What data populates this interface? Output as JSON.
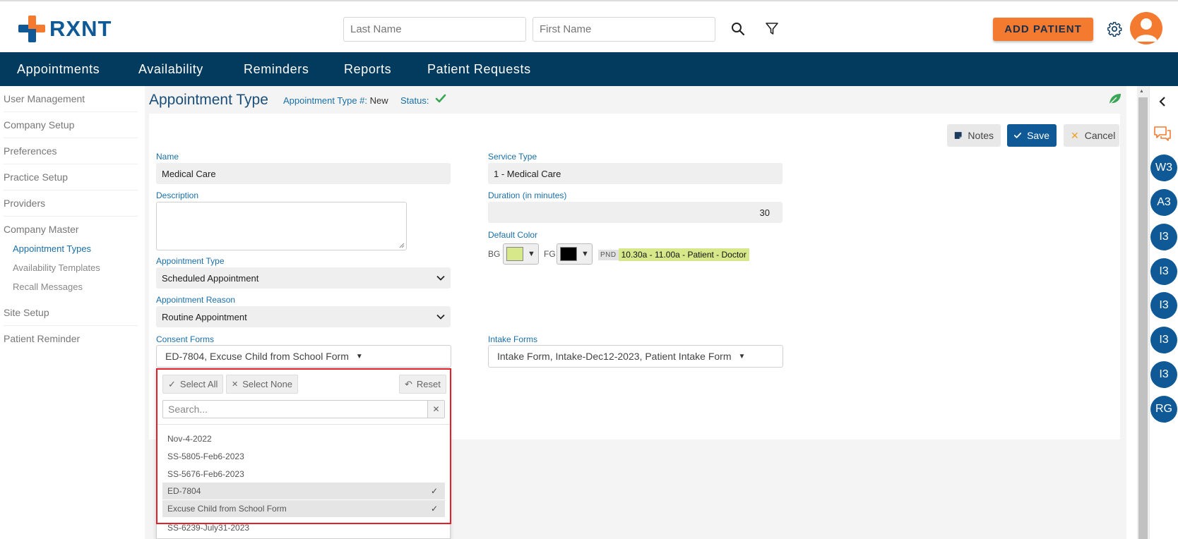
{
  "header": {
    "logo_text": "RXNT",
    "last_name_placeholder": "Last Name",
    "first_name_placeholder": "First Name",
    "add_patient_label": "ADD PATIENT"
  },
  "nav": {
    "items": [
      "Appointments",
      "Availability",
      "Reminders",
      "Reports",
      "Patient Requests"
    ]
  },
  "sidebar": {
    "items": [
      "User Management",
      "Company Setup",
      "Preferences",
      "Practice Setup",
      "Providers",
      "Company Master"
    ],
    "sub_items": [
      "Appointment Types",
      "Availability Templates",
      "Recall Messages"
    ],
    "items_after": [
      "Site Setup",
      "Patient Reminder"
    ]
  },
  "page": {
    "title": "Appointment Type",
    "type_number_label": "Appointment Type #:",
    "type_number_value": "New",
    "status_label": "Status:"
  },
  "actions": {
    "notes": "Notes",
    "save": "Save",
    "cancel": "Cancel"
  },
  "form": {
    "name_label": "Name",
    "name_value": "Medical Care",
    "description_label": "Description",
    "appointment_type_label": "Appointment Type",
    "appointment_type_value": "Scheduled Appointment",
    "appointment_reason_label": "Appointment Reason",
    "appointment_reason_value": "Routine Appointment",
    "consent_forms_label": "Consent Forms",
    "consent_forms_value": "ED-7804,  Excuse Child from School Form",
    "service_type_label": "Service Type",
    "service_type_value": "1 - Medical Care",
    "duration_label": "Duration (in minutes)",
    "duration_value": "30",
    "default_color_label": "Default Color",
    "bg_label": "BG",
    "fg_label": "FG",
    "bg_color": "#d6e88a",
    "fg_color": "#000000",
    "preview_tag": "PND",
    "preview_text": "10.30a - 11.00a - Patient - Doctor",
    "intake_forms_label": "Intake Forms",
    "intake_forms_value": "Intake Form,  Intake-Dec12-2023,  Patient Intake Form"
  },
  "dropdown": {
    "select_all": "Select All",
    "select_none": "Select None",
    "reset": "Reset",
    "search_placeholder": "Search...",
    "options": [
      {
        "label": "Nov-4-2022",
        "selected": false
      },
      {
        "label": "SS-5805-Feb6-2023",
        "selected": false
      },
      {
        "label": "SS-5676-Feb6-2023",
        "selected": false
      },
      {
        "label": "ED-7804",
        "selected": true
      },
      {
        "label": "Excuse Child from School Form",
        "selected": true
      },
      {
        "label": "SS-6239-July31-2023",
        "selected": false
      }
    ]
  },
  "rightbar": {
    "circles": [
      "W3",
      "A3",
      "I3",
      "I3",
      "I3",
      "I3",
      "I3",
      "RG"
    ]
  },
  "colors": {
    "brand_orange": "#f47a30",
    "brand_blue": "#0f5a96",
    "nav_bg": "#023b5e",
    "status_green": "#3aa655"
  }
}
